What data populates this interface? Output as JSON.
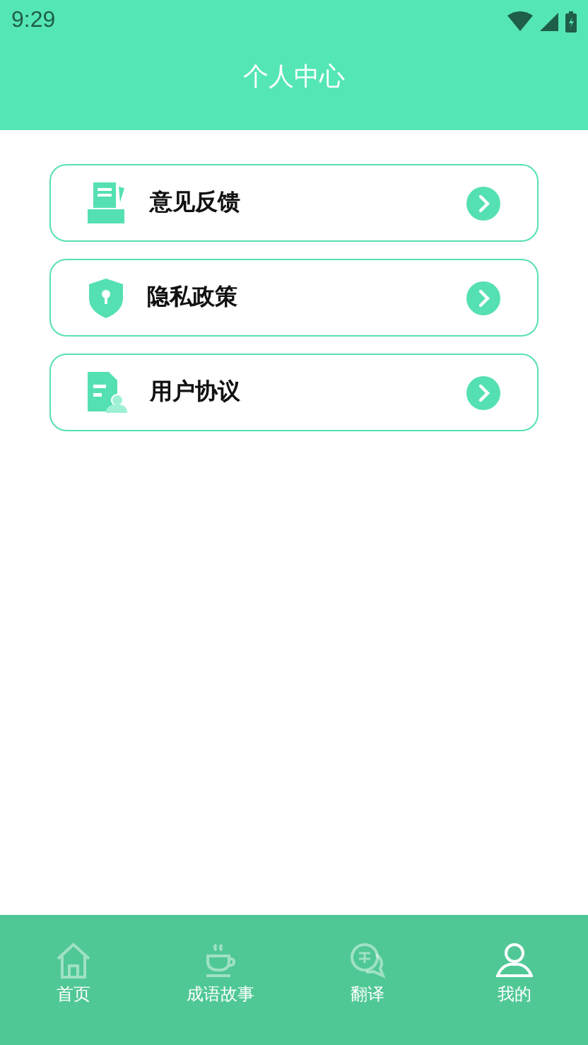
{
  "status_bar": {
    "time": "9:29"
  },
  "header": {
    "title": "个人中心"
  },
  "menu": [
    {
      "label": "意见反馈",
      "kind": "feedback"
    },
    {
      "label": "隐私政策",
      "kind": "privacy"
    },
    {
      "label": "用户协议",
      "kind": "agreement"
    }
  ],
  "tabs": [
    {
      "label": "首页",
      "kind": "home",
      "selected": false
    },
    {
      "label": "成语故事",
      "kind": "cup",
      "selected": false
    },
    {
      "label": "翻译",
      "kind": "translate",
      "selected": false
    },
    {
      "label": "我的",
      "kind": "person",
      "selected": true
    }
  ]
}
